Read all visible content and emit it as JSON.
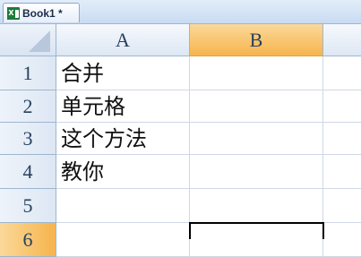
{
  "workbook_tab": {
    "label": "Book1 *",
    "icon": "excel-workbook-icon"
  },
  "columns": [
    "A",
    "B"
  ],
  "rows": [
    {
      "num": "1",
      "a": "合并"
    },
    {
      "num": "2",
      "a": "单元格"
    },
    {
      "num": "3",
      "a": "这个方法"
    },
    {
      "num": "4",
      "a": "教你"
    },
    {
      "num": "5",
      "a": ""
    },
    {
      "num": "6",
      "a": ""
    }
  ],
  "selection": {
    "column": "B",
    "row": "6"
  },
  "colors": {
    "selected_header": "#f6b44c",
    "header": "#dde7f4",
    "gridline": "#d0d7e5"
  }
}
